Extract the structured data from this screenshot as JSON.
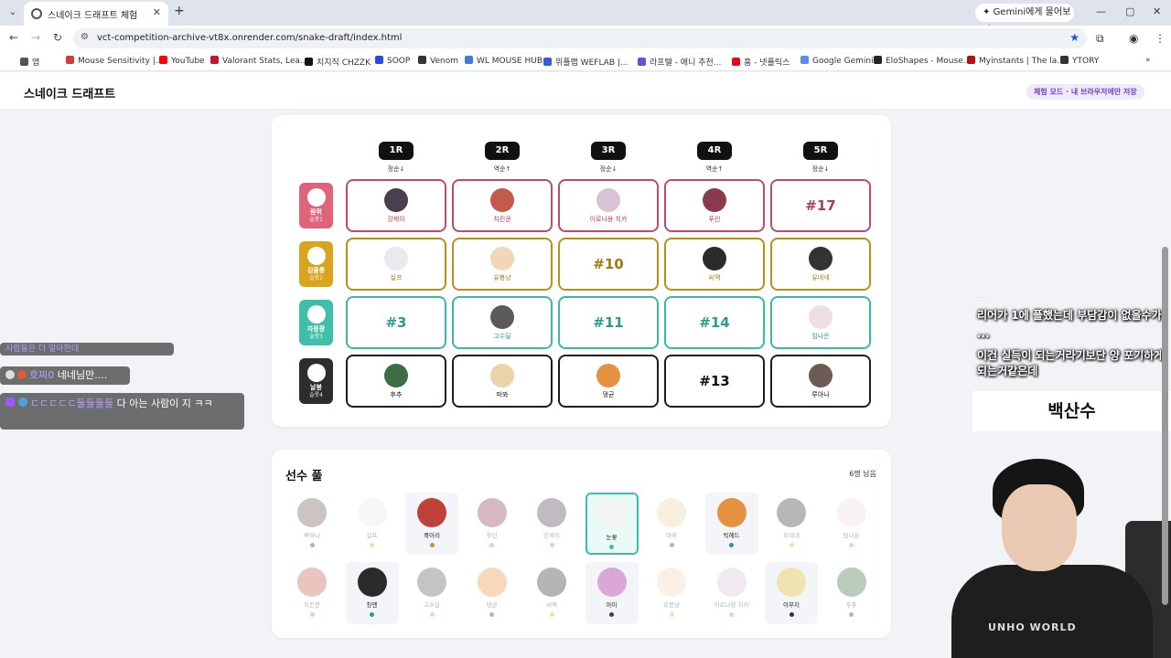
{
  "browser": {
    "tab_title": "스네이크 드래프트 체험",
    "close_glyph": "✕",
    "new_tab_glyph": "+",
    "menu_glyph": "⌄",
    "gemini_label": "Gemini에게 물어보기",
    "url": "vct-competition-archive-vt8x.onrender.com/snake-draft/index.html",
    "bookmarks": [
      "앱",
      "Mouse Sensitivity |...",
      "YouTube",
      "Valorant Stats, Lea...",
      "치지직 CHZZK",
      "SOOP",
      "Venom",
      "WL MOUSE HUB",
      "위플랩 WEFLAB |...",
      "라프텔 - 애니 추천...",
      "홈 - 넷플릭스",
      "Google Gemini",
      "EloShapes - Mouse...",
      "Myinstants | The la...",
      "YTORY"
    ]
  },
  "page": {
    "title": "스네이크 드래프트",
    "mode_badge": "체험 모드 · 내 브라우저에만 저장"
  },
  "rounds": [
    {
      "label": "1R",
      "dir": "정순↓"
    },
    {
      "label": "2R",
      "dir": "역순↑"
    },
    {
      "label": "3R",
      "dir": "정순↓"
    },
    {
      "label": "4R",
      "dir": "역순↑"
    },
    {
      "label": "5R",
      "dir": "정순↓"
    }
  ],
  "teams": [
    {
      "name": "람쥐",
      "slot": "슬롯1",
      "color": "#e0637c",
      "border": "#c04a6a",
      "text": "#b23a5c",
      "picks": [
        {
          "type": "player",
          "name": "강제이",
          "avatar": "#4a3f4f"
        },
        {
          "type": "player",
          "name": "치킨쿤",
          "avatar": "#c45a4a"
        },
        {
          "type": "player",
          "name": "이로나용 치카",
          "avatar": "#d9c3d6"
        },
        {
          "type": "player",
          "name": "푸린",
          "avatar": "#8a3a4c"
        },
        {
          "type": "pick",
          "label": "#17"
        }
      ]
    },
    {
      "name": "김올롱",
      "slot": "슬롯2",
      "color": "#d9a31d",
      "border": "#b99017",
      "text": "#a07c10",
      "picks": [
        {
          "type": "player",
          "name": "실프",
          "avatar": "#e9e9ee"
        },
        {
          "type": "player",
          "name": "유봉냥",
          "avatar": "#f1d7b8"
        },
        {
          "type": "pick",
          "label": "#10"
        },
        {
          "type": "player",
          "name": "씨맥",
          "avatar": "#2b2b2b"
        },
        {
          "type": "player",
          "name": "유네네",
          "avatar": "#333333"
        }
      ]
    },
    {
      "name": "자몽팡",
      "slot": "슬롯3",
      "color": "#3fbfa9",
      "border": "#3cb8a2",
      "text": "#2c9c88",
      "picks": [
        {
          "type": "pick",
          "label": "#3"
        },
        {
          "type": "player",
          "name": "고수달",
          "avatar": "#5a5a5a"
        },
        {
          "type": "pick",
          "label": "#11"
        },
        {
          "type": "pick",
          "label": "#14"
        },
        {
          "type": "player",
          "name": "임나은",
          "avatar": "#eedfe4"
        }
      ]
    },
    {
      "name": "날봉",
      "slot": "슬롯4",
      "color": "#2d2d2d",
      "border": "#1d1d1d",
      "text": "#111111",
      "picks": [
        {
          "type": "player",
          "name": "후추",
          "avatar": "#3b6e46"
        },
        {
          "type": "player",
          "name": "마뫄",
          "avatar": "#ead3a6"
        },
        {
          "type": "player",
          "name": "댕균",
          "avatar": "#e6913f"
        },
        {
          "type": "pick",
          "label": "#13"
        },
        {
          "type": "player",
          "name": "루아나",
          "avatar": "#6c5a54"
        }
      ]
    }
  ],
  "pool": {
    "title": "선수 풀",
    "remaining": "6명 남음",
    "rows": [
      [
        {
          "name": "루아나",
          "state": "dim",
          "avatar": "#6c5a54",
          "dot": "#2d2d2d"
        },
        {
          "name": "실프",
          "state": "dim",
          "avatar": "#e9e9ee",
          "dot": "#d9a31d"
        },
        {
          "name": "쿡이리",
          "state": "avail",
          "avatar": "#c0403a",
          "dot": "#b59a2a"
        },
        {
          "name": "푸린",
          "state": "dim",
          "avatar": "#8a3a4c",
          "dot": "#e0637c"
        },
        {
          "name": "강제이",
          "state": "dim",
          "avatar": "#4a3f4f",
          "dot": "#e0637c"
        },
        {
          "name": "눈꽃",
          "state": "sel",
          "avatar": "#f5f5f5",
          "dot": "#3fbfa9"
        },
        {
          "name": "마뫄",
          "state": "dim",
          "avatar": "#ead3a6",
          "dot": "#2d2d2d"
        },
        {
          "name": "빅헤드",
          "state": "avail",
          "avatar": "#e6913f",
          "dot": "#2c9c88"
        },
        {
          "name": "유네네",
          "state": "dim",
          "avatar": "#333333",
          "dot": "#d9a31d"
        },
        {
          "name": "임나은",
          "state": "dim",
          "avatar": "#eedfe4",
          "dot": "#3fbfa9"
        }
      ],
      [
        {
          "name": "치킨쿤",
          "state": "dim",
          "avatar": "#c45a4a",
          "dot": "#e0637c"
        },
        {
          "name": "칭맨",
          "state": "avail",
          "avatar": "#2b2b2b",
          "dot": "#2c9c88"
        },
        {
          "name": "고수달",
          "state": "dim",
          "avatar": "#5a5a5a",
          "dot": "#3fbfa9"
        },
        {
          "name": "댕균",
          "state": "dim",
          "avatar": "#e6913f",
          "dot": "#2d2d2d"
        },
        {
          "name": "씨맥",
          "state": "dim",
          "avatar": "#2b2b2b",
          "dot": "#d9a31d"
        },
        {
          "name": "아이",
          "state": "avail",
          "avatar": "#d9a8d6",
          "dot": "#5a2a7a"
        },
        {
          "name": "유봉냥",
          "state": "dim",
          "avatar": "#f1d7b8",
          "dot": "#d9a31d"
        },
        {
          "name": "이로나용 치카",
          "state": "dim",
          "avatar": "#d9c3d6",
          "dot": "#e0637c"
        },
        {
          "name": "이무지",
          "state": "avail",
          "avatar": "#f0e3b0",
          "dot": "#3a2a6a"
        },
        {
          "name": "후추",
          "state": "dim",
          "avatar": "#3b6e46",
          "dot": "#2d2d2d"
        }
      ]
    ]
  },
  "overlay": {
    "chat_partial": "사람들은 다 알아한데",
    "chat1_nick": "호찌0",
    "chat1_text": "네네님만....",
    "chat2_nick": "ㄷㄷㄷㄷㄷ둘둘둘둘",
    "chat2_text": "다 아는 사람이 지 ㅋㅋ",
    "sub_small": "·····",
    "sub1": "리어가 1에 플했는데 부담감이 없을수가",
    "sub2": "...",
    "sub3": "이건 실득이 되는거라기보단 양 포기하게 되는거같은데",
    "banner_name": "백산수",
    "shirt_text": "UNHO WORLD"
  }
}
